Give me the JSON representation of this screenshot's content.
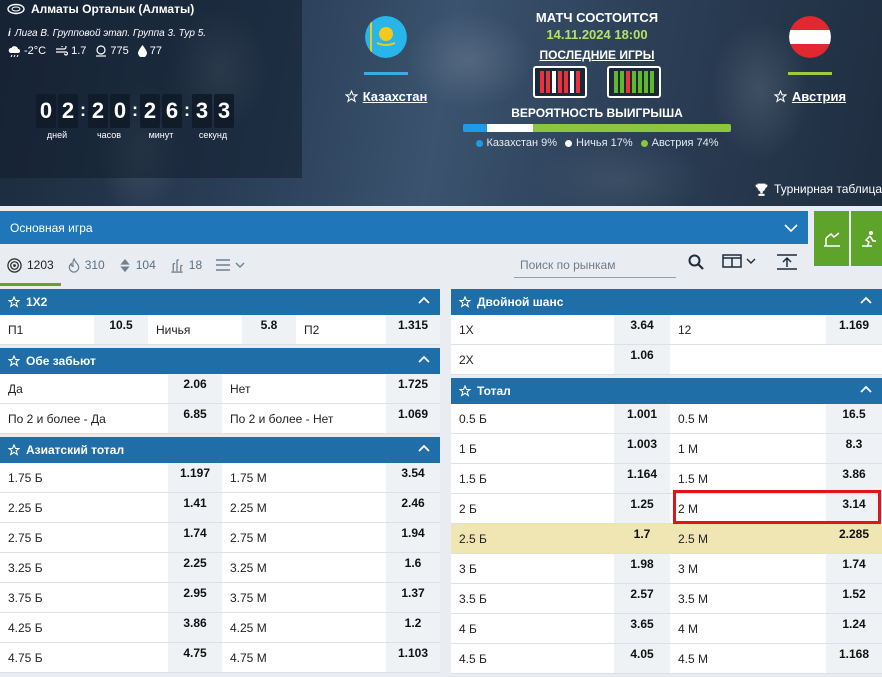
{
  "match": {
    "stadium": "Алматы Орталык (Алматы)",
    "league": "Лига B. Групповой этап. Группа 3. Тур 5.",
    "weather": {
      "temp": "-2°C",
      "wind": "1.7",
      "pressure": "775",
      "humidity": "77"
    },
    "countdown": {
      "days": [
        "0",
        "2"
      ],
      "hours": [
        "2",
        "0"
      ],
      "minutes": [
        "2",
        "6"
      ],
      "seconds": [
        "3",
        "3"
      ],
      "labels": {
        "days": "дней",
        "hours": "часов",
        "minutes": "минут",
        "seconds": "секунд"
      }
    },
    "home": {
      "name": "Казахстан",
      "color": "#3fa9e8"
    },
    "away": {
      "name": "Австрия",
      "color": "#9ccc3c"
    },
    "status": "МАТЧ СОСТОИТСЯ",
    "datetime": "14.11.2024 18:00",
    "last_games": "ПОСЛЕДНИЕ ИГРЫ",
    "win_prob_title": "ВЕРОЯТНОСТЬ ВЫИГРЫША",
    "probs": [
      {
        "label": "Казахстан 9%",
        "value": 9,
        "color": "#1e9be8"
      },
      {
        "label": "Ничья 17%",
        "value": 17,
        "color": "#ffffff"
      },
      {
        "label": "Австрия 74%",
        "value": 74,
        "color": "#8cc63f"
      }
    ],
    "tournament_table": "Турнирная таблица"
  },
  "tabs": {
    "main_game": "Основная игра",
    "filters": [
      {
        "icon": "target-icon",
        "count": "1203"
      },
      {
        "icon": "fire-icon",
        "count": "310"
      },
      {
        "icon": "sort-icon",
        "count": "104"
      },
      {
        "icon": "stats-icon",
        "count": "18"
      }
    ],
    "search_placeholder": "Поиск по рынкам"
  },
  "markets": {
    "x12": {
      "title": "1X2",
      "rows": [
        [
          {
            "label": "П1",
            "odd": "10.5"
          },
          {
            "label": "Ничья",
            "odd": "5.8"
          },
          {
            "label": "П2",
            "odd": "1.315"
          }
        ]
      ]
    },
    "both_score": {
      "title": "Обе забьют",
      "rows": [
        [
          {
            "label": "Да",
            "odd": "2.06"
          },
          {
            "label": "Нет",
            "odd": "1.725"
          }
        ],
        [
          {
            "label": "По 2 и более - Да",
            "odd": "6.85"
          },
          {
            "label": "По 2 и более - Нет",
            "odd": "1.069"
          }
        ]
      ]
    },
    "asian_total": {
      "title": "Азиатский тотал",
      "rows": [
        [
          {
            "label": "1.75 Б",
            "odd": "1.197"
          },
          {
            "label": "1.75 М",
            "odd": "3.54"
          }
        ],
        [
          {
            "label": "2.25 Б",
            "odd": "1.41"
          },
          {
            "label": "2.25 М",
            "odd": "2.46"
          }
        ],
        [
          {
            "label": "2.75 Б",
            "odd": "1.74"
          },
          {
            "label": "2.75 М",
            "odd": "1.94"
          }
        ],
        [
          {
            "label": "3.25 Б",
            "odd": "2.25"
          },
          {
            "label": "3.25 М",
            "odd": "1.6"
          }
        ],
        [
          {
            "label": "3.75 Б",
            "odd": "2.95"
          },
          {
            "label": "3.75 М",
            "odd": "1.37"
          }
        ],
        [
          {
            "label": "4.25 Б",
            "odd": "3.86"
          },
          {
            "label": "4.25 М",
            "odd": "1.2"
          }
        ],
        [
          {
            "label": "4.75 Б",
            "odd": "4.75"
          },
          {
            "label": "4.75 М",
            "odd": "1.103"
          }
        ]
      ]
    },
    "double_chance": {
      "title": "Двойной шанс",
      "rows": [
        [
          {
            "label": "1X",
            "odd": "3.64"
          },
          {
            "label": "12",
            "odd": "1.169"
          }
        ],
        [
          {
            "label": "2X",
            "odd": "1.06"
          }
        ]
      ]
    },
    "total": {
      "title": "Тотал",
      "rows": [
        [
          {
            "label": "0.5 Б",
            "odd": "1.001"
          },
          {
            "label": "0.5 М",
            "odd": "16.5"
          }
        ],
        [
          {
            "label": "1 Б",
            "odd": "1.003"
          },
          {
            "label": "1 М",
            "odd": "8.3"
          }
        ],
        [
          {
            "label": "1.5 Б",
            "odd": "1.164"
          },
          {
            "label": "1.5 М",
            "odd": "3.86"
          }
        ],
        [
          {
            "label": "2 Б",
            "odd": "1.25"
          },
          {
            "label": "2 М",
            "odd": "3.14"
          }
        ],
        [
          {
            "label": "2.5 Б",
            "odd": "1.7"
          },
          {
            "label": "2.5 М",
            "odd": "2.285"
          }
        ],
        [
          {
            "label": "3 Б",
            "odd": "1.98"
          },
          {
            "label": "3 М",
            "odd": "1.74"
          }
        ],
        [
          {
            "label": "3.5 Б",
            "odd": "2.57"
          },
          {
            "label": "3.5 М",
            "odd": "1.52"
          }
        ],
        [
          {
            "label": "4 Б",
            "odd": "3.65"
          },
          {
            "label": "4 М",
            "odd": "1.24"
          }
        ],
        [
          {
            "label": "4.5 Б",
            "odd": "4.05"
          },
          {
            "label": "4.5 М",
            "odd": "1.168"
          }
        ]
      ]
    }
  }
}
